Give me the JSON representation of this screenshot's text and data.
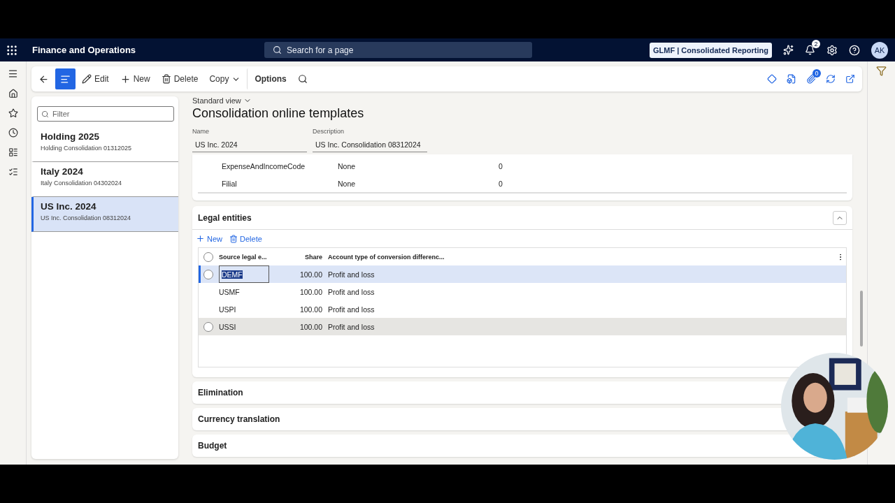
{
  "header": {
    "app_name": "Finance and Operations",
    "search_placeholder": "Search for a page",
    "company": "GLMF | Consolidated Reporting",
    "notifications": "2",
    "avatar": "AK"
  },
  "action_bar": {
    "buttons": [
      {
        "kind": "back"
      },
      {
        "kind": "list",
        "selected": true
      },
      {
        "kind": "edit",
        "label": "Edit"
      },
      {
        "kind": "new",
        "label": "New"
      },
      {
        "kind": "delete",
        "label": "Delete"
      },
      {
        "kind": "copy",
        "label": "Copy"
      },
      {
        "kind": "options",
        "label": "Options"
      },
      {
        "kind": "search"
      }
    ],
    "attachments_count": "0"
  },
  "list": {
    "filter_placeholder": "Filter",
    "items": [
      {
        "title": "Holding 2025",
        "subtitle": "Holding Consolidation 01312025",
        "selected": false
      },
      {
        "title": "Italy 2024",
        "subtitle": "Italy Consolidation 04302024",
        "selected": false
      },
      {
        "title": "US Inc. 2024",
        "subtitle": "US Inc. Consolidation 08312024",
        "selected": true
      }
    ]
  },
  "view": "Standard view",
  "title": "Consolidation online templates",
  "fields": [
    {
      "label": "Name",
      "value": "US Inc. 2024"
    },
    {
      "label": "Description",
      "value": "US Inc. Consolidation 08312024"
    }
  ],
  "dimension_rows": [
    {
      "name": "ExpenseAndIncomeCode",
      "value": "None",
      "count": "0"
    },
    {
      "name": "Filial",
      "value": "None",
      "count": "0"
    }
  ],
  "legal_entities": {
    "title": "Legal entities",
    "expanded": true,
    "toolbar": [
      "New",
      "Delete"
    ],
    "all_selected": false,
    "columns": [
      "Source legal e...",
      "Share",
      "Account type of conversion differenc..."
    ],
    "rows": [
      {
        "source": "DEMF",
        "share": "100.00",
        "account_type": "Profit and loss",
        "selected": true,
        "hovered": false
      },
      {
        "source": "USMF",
        "share": "100.00",
        "account_type": "Profit and loss",
        "selected": false,
        "hovered": false
      },
      {
        "source": "USPI",
        "share": "100.00",
        "account_type": "Profit and loss",
        "selected": false,
        "hovered": false
      },
      {
        "source": "USSI",
        "share": "100.00",
        "account_type": "Profit and loss",
        "selected": false,
        "hovered": true
      }
    ]
  },
  "sections": [
    {
      "title": "Elimination"
    },
    {
      "title": "Currency translation"
    },
    {
      "title": "Budget"
    }
  ]
}
